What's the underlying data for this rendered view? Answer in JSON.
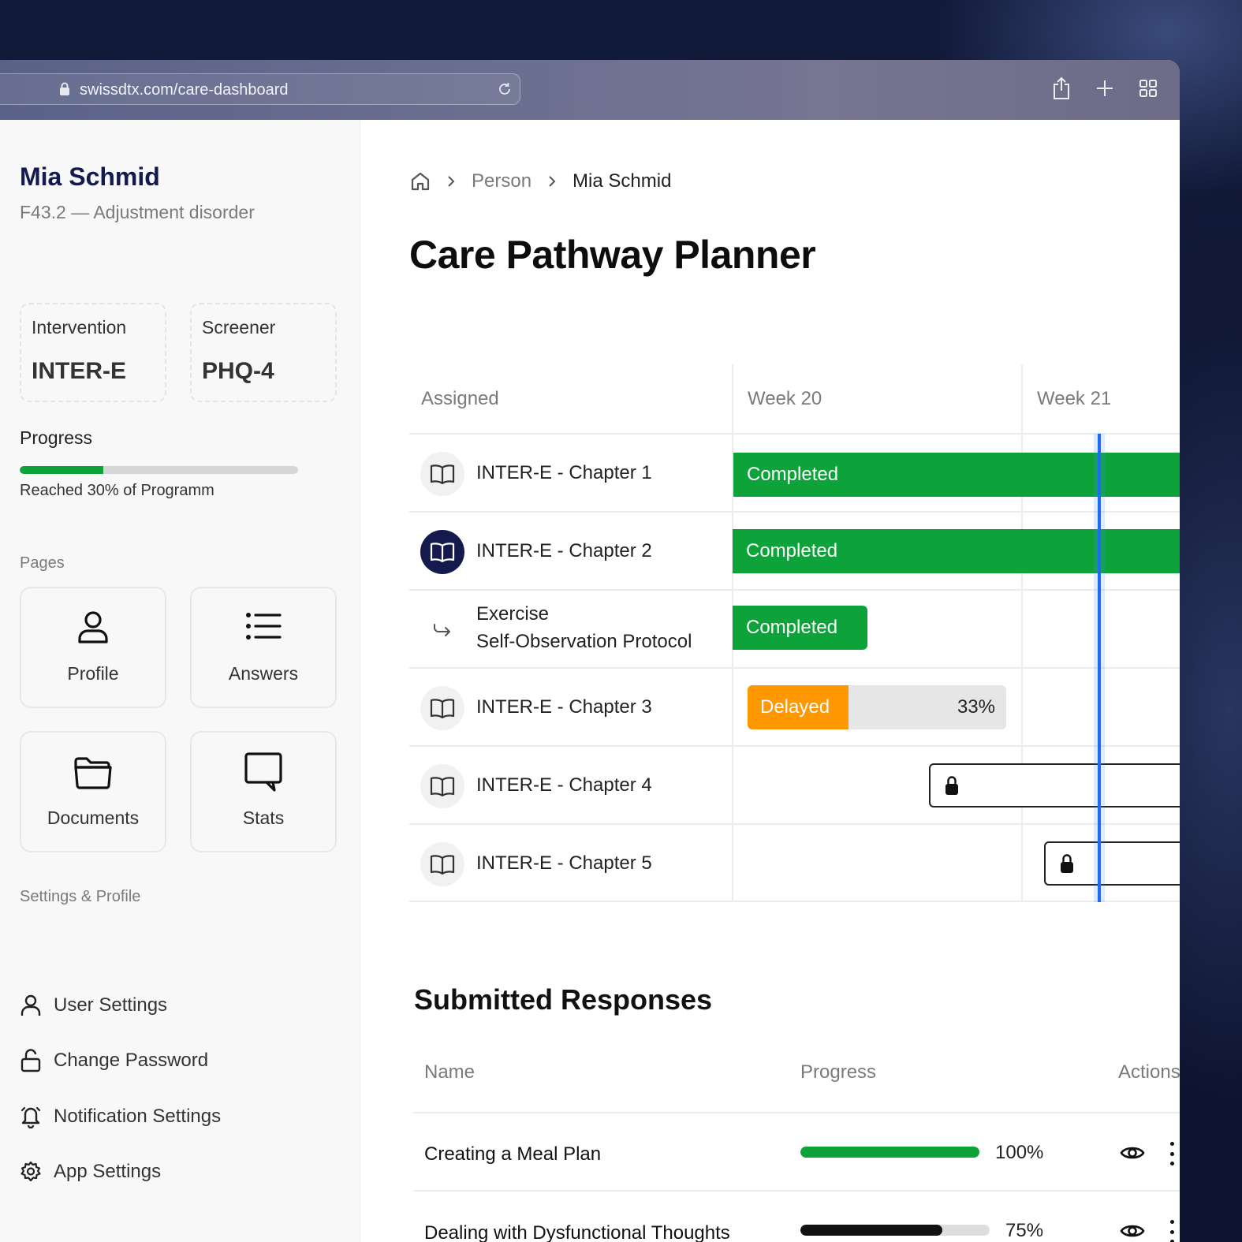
{
  "browser": {
    "url": "swissdtx.com/care-dashboard"
  },
  "sidebar": {
    "patient_name": "Mia Schmid",
    "diagnosis": "F43.2 — Adjustment disorder",
    "intervention": {
      "label": "Intervention",
      "value": "INTER-E"
    },
    "screener": {
      "label": "Screener",
      "value": "PHQ-4"
    },
    "progress": {
      "title": "Progress",
      "fraction": 0.3,
      "text": "Reached 30% of Programm"
    },
    "pages_label": "Pages",
    "pages": [
      {
        "label": "Profile",
        "icon": "person-icon"
      },
      {
        "label": "Answers",
        "icon": "list-icon"
      },
      {
        "label": "Documents",
        "icon": "folder-icon"
      },
      {
        "label": "Stats",
        "icon": "chat-bubble-icon"
      }
    ],
    "settings_label": "Settings & Profile",
    "settings": [
      {
        "label": "User Settings",
        "icon": "user-icon"
      },
      {
        "label": "Change Password",
        "icon": "unlock-icon"
      },
      {
        "label": "Notification Settings",
        "icon": "bell-icon"
      },
      {
        "label": "App Settings",
        "icon": "gear-icon"
      }
    ]
  },
  "breadcrumb": {
    "home_icon": "home-icon",
    "items": [
      "Person",
      "Mia Schmid"
    ]
  },
  "page_title": "Care Pathway Planner",
  "planner": {
    "columns": [
      "Assigned",
      "Week 20",
      "Week 21"
    ],
    "rows": [
      {
        "title": "INTER-E - Chapter 1",
        "icon": "book-icon",
        "status": "Completed"
      },
      {
        "title": "INTER-E - Chapter 2",
        "icon": "book-icon",
        "status": "Completed"
      },
      {
        "title_line1": "Exercise",
        "title_line2": "Self-Observation Protocol",
        "icon": "exercise-arrow-icon",
        "status": "Completed"
      },
      {
        "title": "INTER-E - Chapter 3",
        "icon": "book-icon",
        "status": "Delayed",
        "percent": "33%"
      },
      {
        "title": "INTER-E - Chapter 4",
        "icon": "book-icon",
        "status_icon": "lock-icon"
      },
      {
        "title": "INTER-E - Chapter 5",
        "icon": "book-icon",
        "status_icon": "lock-icon"
      }
    ]
  },
  "responses": {
    "title": "Submitted Responses",
    "headers": {
      "name": "Name",
      "progress": "Progress",
      "actions": "Actions"
    },
    "rows": [
      {
        "name": "Creating a Meal Plan",
        "progress": 1.0,
        "progress_text": "100%",
        "color": "#0ea33a"
      },
      {
        "name": "Dealing with Dysfunctional Thoughts",
        "progress": 0.75,
        "progress_text": "75%",
        "color": "#111111"
      }
    ]
  },
  "colors": {
    "completed": "#0ea33a",
    "delayed": "#ff9800",
    "today_line": "#1d6cf2",
    "brand_navy": "#141a4e"
  }
}
